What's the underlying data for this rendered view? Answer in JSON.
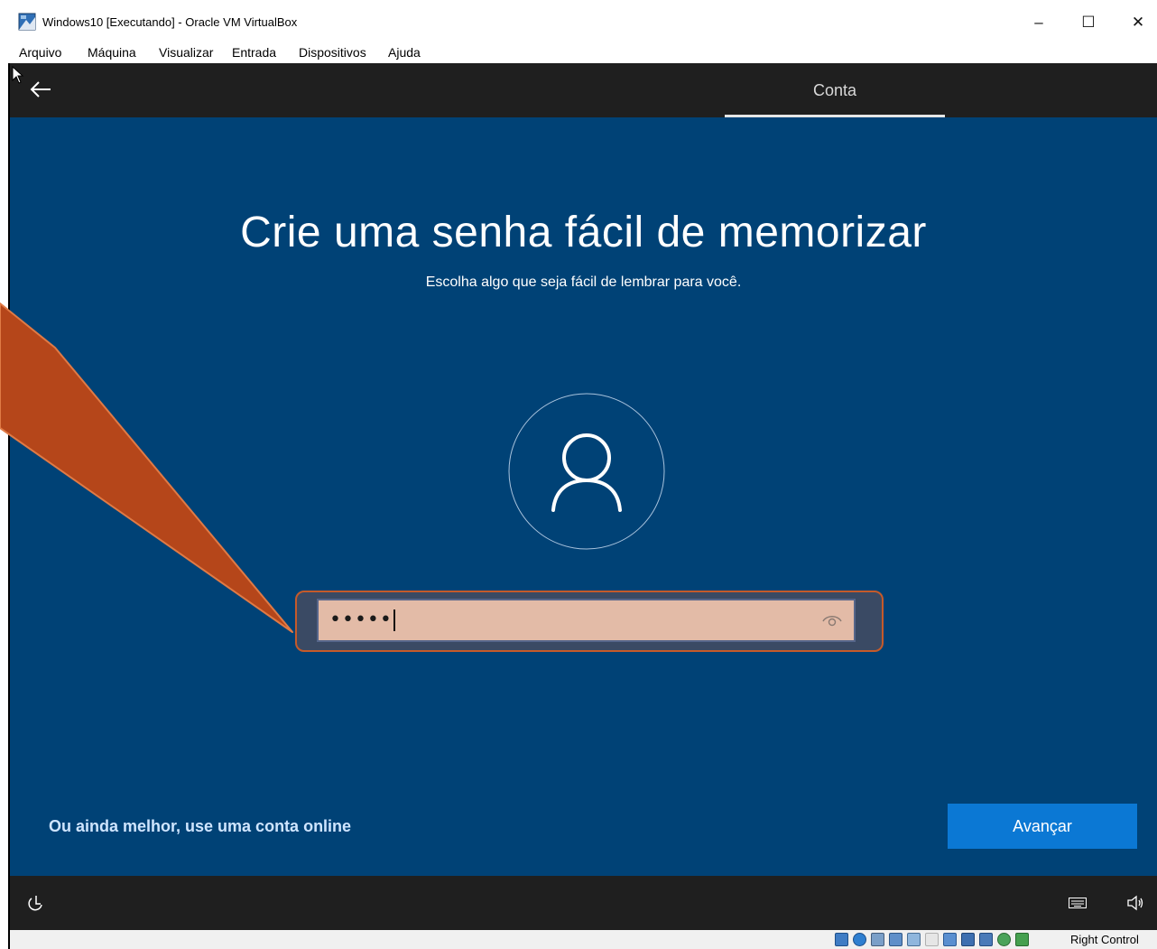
{
  "window": {
    "title": "Windows10 [Executando] - Oracle VM VirtualBox",
    "controls": {
      "minimize": "–",
      "maximize": "☐",
      "close": "✕"
    }
  },
  "menu": [
    "Arquivo",
    "Máquina",
    "Visualizar",
    "Entrada",
    "Dispositivos",
    "Ajuda"
  ],
  "oobe": {
    "top_tab": "Conta",
    "heading": "Crie uma senha fácil de memorizar",
    "subheading": "Escolha algo que seja fácil de lembrar para você.",
    "password": {
      "masked_value": "•••••"
    },
    "online_account_link": "Ou ainda melhor, use uma conta online",
    "next_button": "Avançar"
  },
  "statusbar": {
    "host_key": "Right Control"
  },
  "colors": {
    "oobe_background": "#004276",
    "dark_bar": "#1f1f1f",
    "accent_button": "#0b78d4",
    "annotation": "#b5461a",
    "password_highlight": "#e3bba7"
  }
}
